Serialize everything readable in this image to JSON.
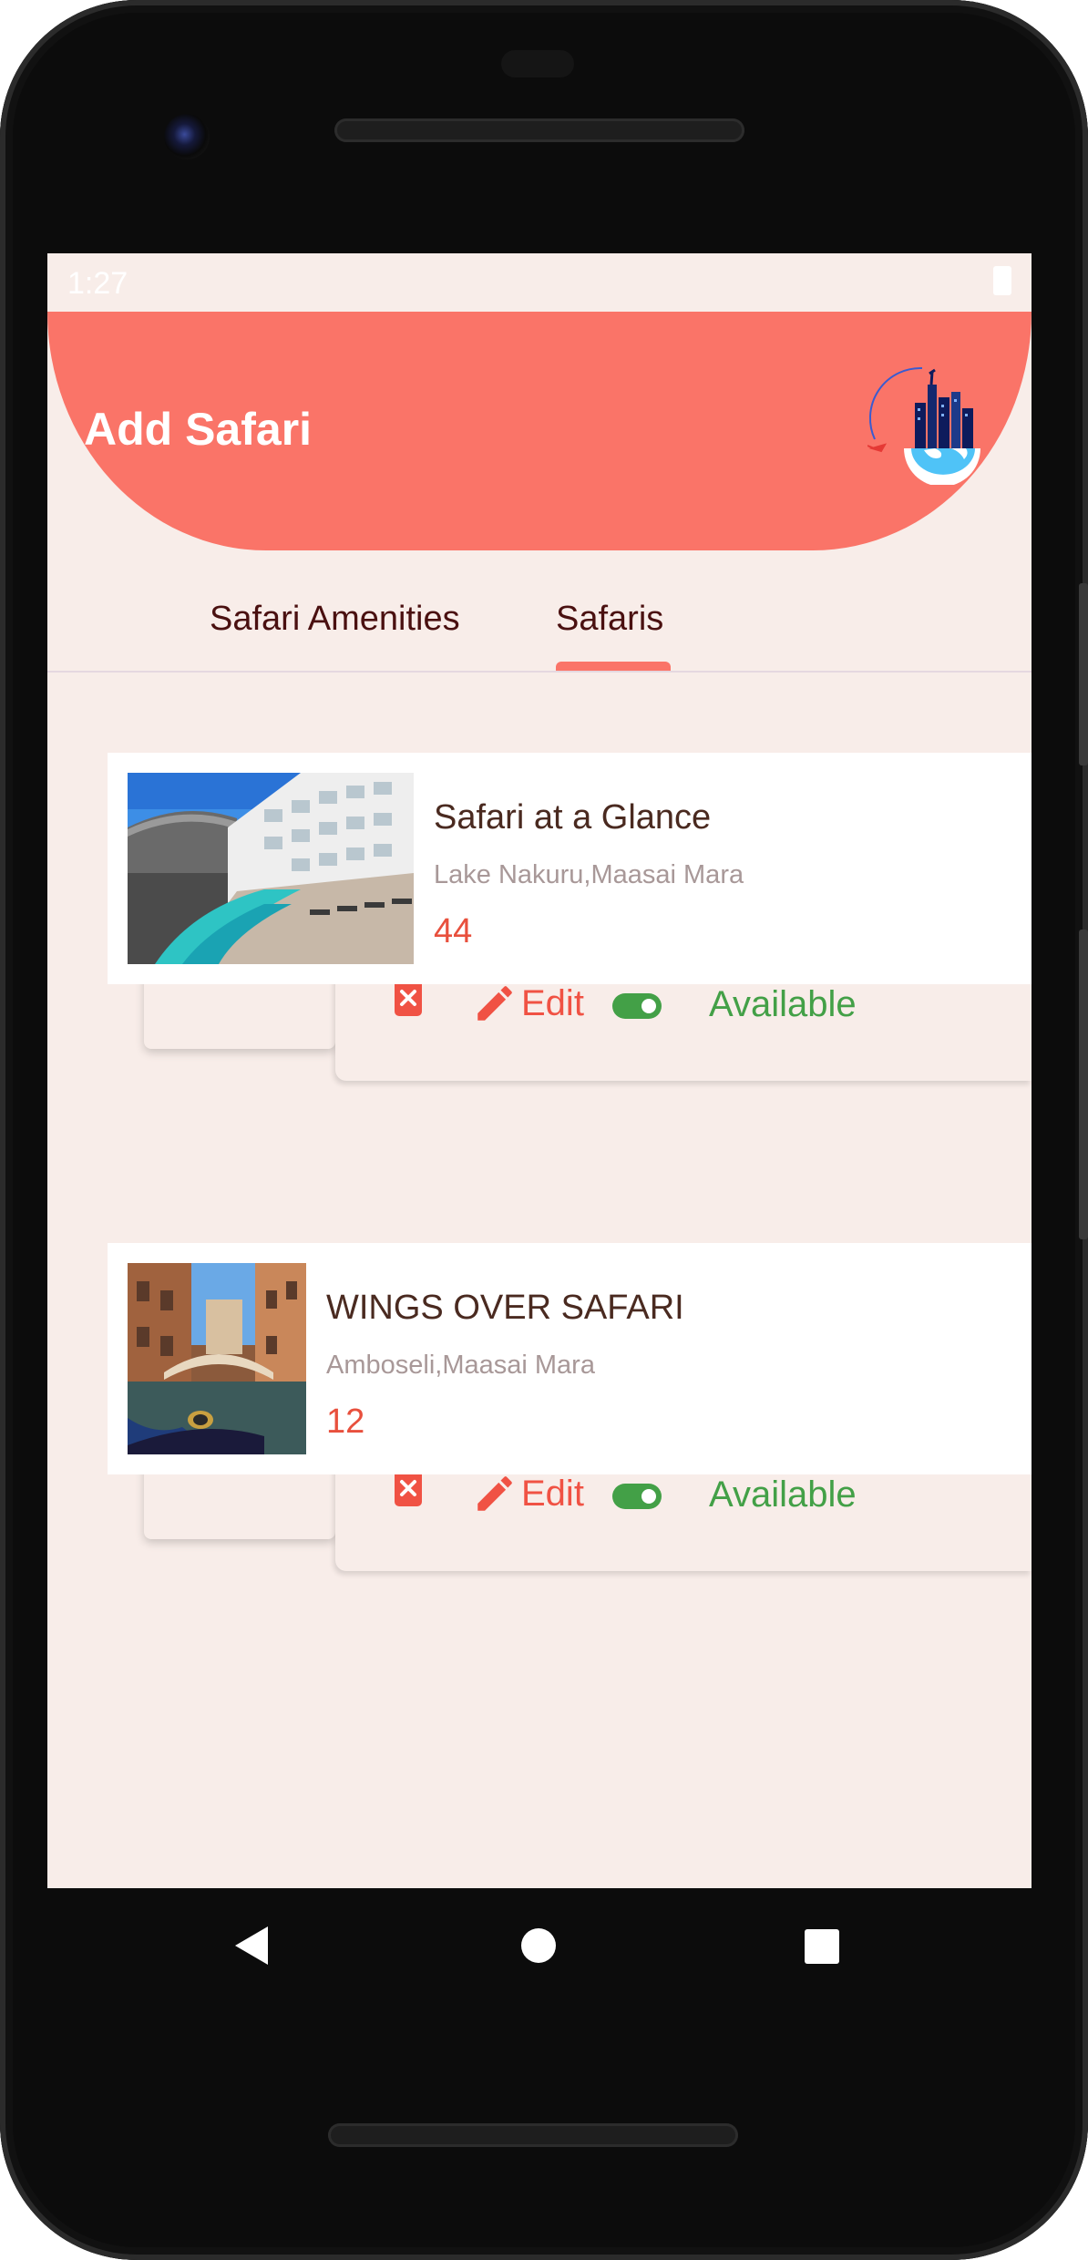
{
  "status": {
    "time": "1:27"
  },
  "header": {
    "title": "Add Safari"
  },
  "tabs": [
    {
      "label": "Safari Amenities"
    },
    {
      "label": "Safaris"
    }
  ],
  "safaris": [
    {
      "title": "Safari at a Glance",
      "location": "Lake Nakuru,Maasai Mara",
      "count": "44",
      "edit_label": "Edit",
      "availability_label": "Available"
    },
    {
      "title": "WINGS OVER SAFARI",
      "location": "Amboseli,Maasai Mara",
      "count": "12",
      "edit_label": "Edit",
      "availability_label": "Available"
    }
  ],
  "colors": {
    "header": "#fa7468",
    "background": "#f8ede9",
    "delete_icon": "#f05244",
    "available": "#43a047"
  },
  "icons": [
    "battery-icon",
    "logo-icon",
    "delete-icon",
    "edit-icon",
    "toggle-icon",
    "back-icon",
    "home-icon",
    "recents-icon"
  ]
}
